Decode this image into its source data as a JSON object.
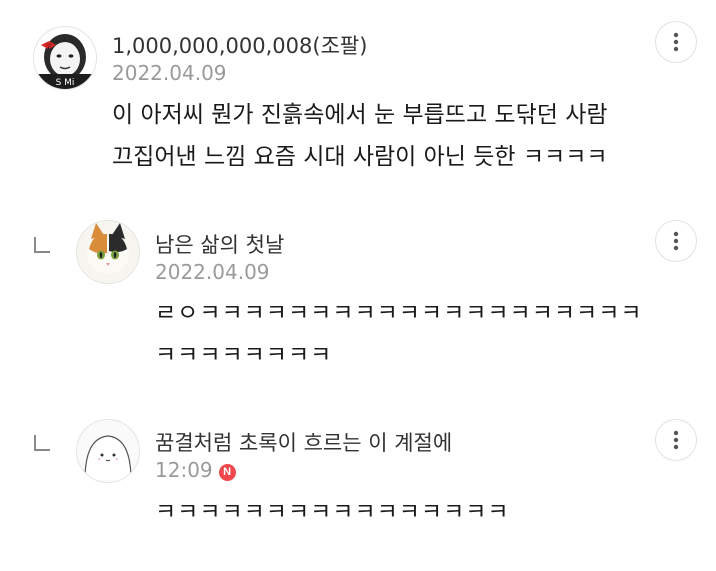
{
  "comments": [
    {
      "author": "1,000,000,000,008(조팔)",
      "date": "2022.04.09",
      "lines": [
        "이 아저씨 뭔가 진흙속에서 눈 부릅뜨고 도닦던 사람",
        "끄집어낸 느낌 요즘 시대 사람이 아닌 듯한 ㅋㅋㅋㅋ"
      ],
      "avatar_text": "S Mi"
    },
    {
      "author": "남은 삶의 첫날",
      "date": "2022.04.09",
      "lines": [
        "ㄹㅇㅋㅋㅋㅋㅋㅋㅋㅋㅋㅋㅋㅋㅋㅋㅋㅋㅋㅋㅋㅋ",
        "ㅋㅋㅋㅋㅋㅋㅋㅋ"
      ]
    },
    {
      "author": "꿈결처럼 초록이 흐르는 이 계절에",
      "date": "12:09",
      "badge": "N",
      "lines": [
        "ㅋㅋㅋㅋㅋㅋㅋㅋㅋㅋㅋㅋㅋㅋㅋㅋ"
      ]
    }
  ],
  "icons": {
    "more": "more-vertical-icon",
    "reply": "reply-arrow-icon"
  },
  "colors": {
    "new_badge": "#f0484d",
    "date": "#9a9a9a"
  }
}
